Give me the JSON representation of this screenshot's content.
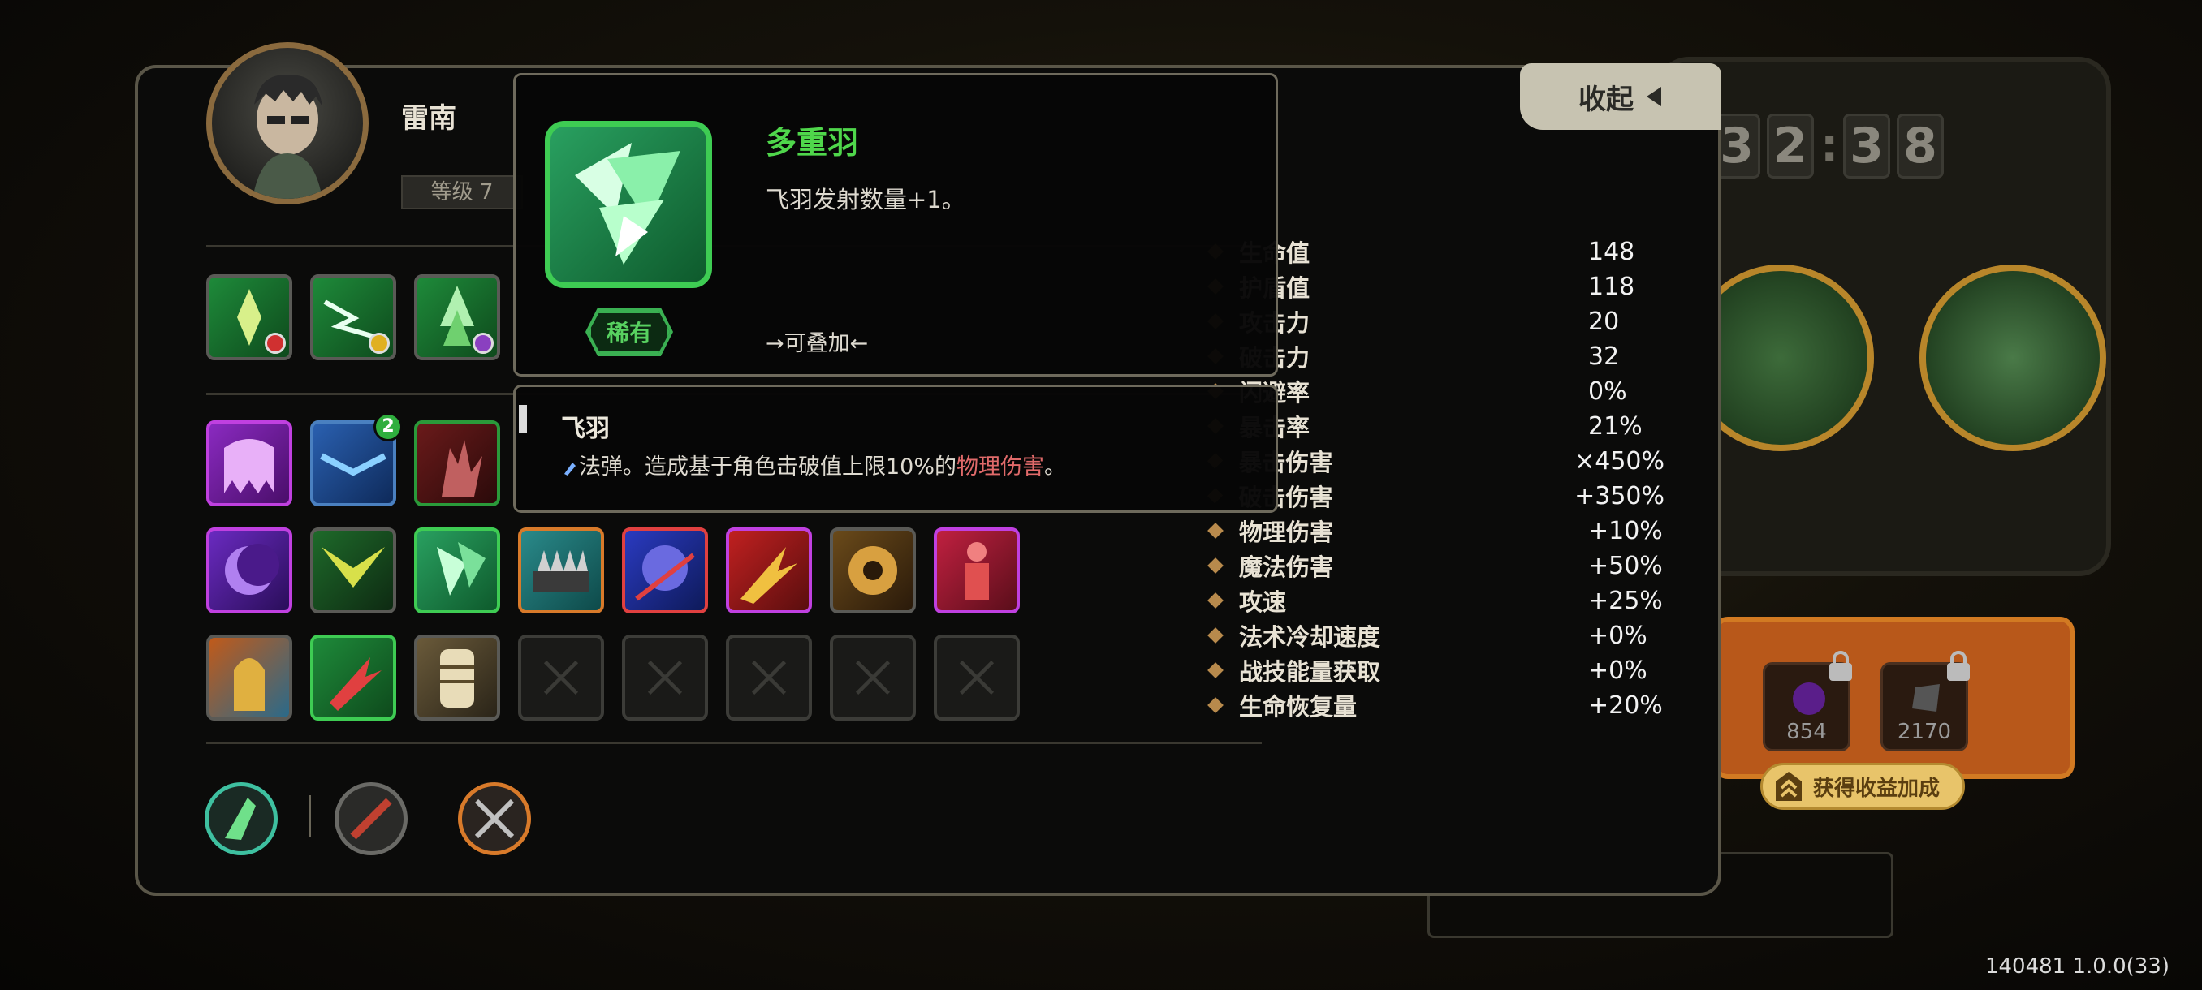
{
  "timer": {
    "d1": "3",
    "d2": "2",
    "d3": "3",
    "d4": "8",
    "sep": ":"
  },
  "resources": [
    {
      "value": "854",
      "icon": "purple-orb-icon"
    },
    {
      "value": "2170",
      "icon": "gray-crystal-icon"
    }
  ],
  "earn_bonus_label": "获得收益加成",
  "version": "140481 1.0.0(33)",
  "character": {
    "name": "雷南",
    "level": "等级 7"
  },
  "collapse_label": "收起",
  "stats": [
    {
      "name": "生命值",
      "value": "148"
    },
    {
      "name": "护盾值",
      "value": "118"
    },
    {
      "name": "攻击力",
      "value": "20"
    },
    {
      "name": "破击力",
      "value": "32"
    },
    {
      "name": "闪避率",
      "value": "0%"
    },
    {
      "name": "暴击率",
      "value": "21%"
    },
    {
      "name": "暴击伤害",
      "value": "×450%"
    },
    {
      "name": "破击伤害",
      "value": "+350%"
    },
    {
      "name": "物理伤害",
      "value": "+10%"
    },
    {
      "name": "魔法伤害",
      "value": "+50%"
    },
    {
      "name": "攻速",
      "value": "+25%"
    },
    {
      "name": "法术冷却速度",
      "value": "+0%"
    },
    {
      "name": "战技能量获取",
      "value": "+0%"
    },
    {
      "name": "生命恢复量",
      "value": "+20%"
    }
  ],
  "skill_popup": {
    "title": "多重羽",
    "desc": "飞羽发射数量+1。",
    "rarity": "稀有",
    "stackable": "→可叠加←"
  },
  "weapon_popup": {
    "title": "飞羽",
    "desc_prefix": "法弹。造成基于角色击破值上限10%的",
    "desc_dmg": "物理伤害",
    "desc_suffix": "。"
  },
  "inventory_badge": "2",
  "colors": {
    "green_accent": "#4fd64b",
    "damage_red": "#e06a6a",
    "panel_border": "#5a5648"
  }
}
